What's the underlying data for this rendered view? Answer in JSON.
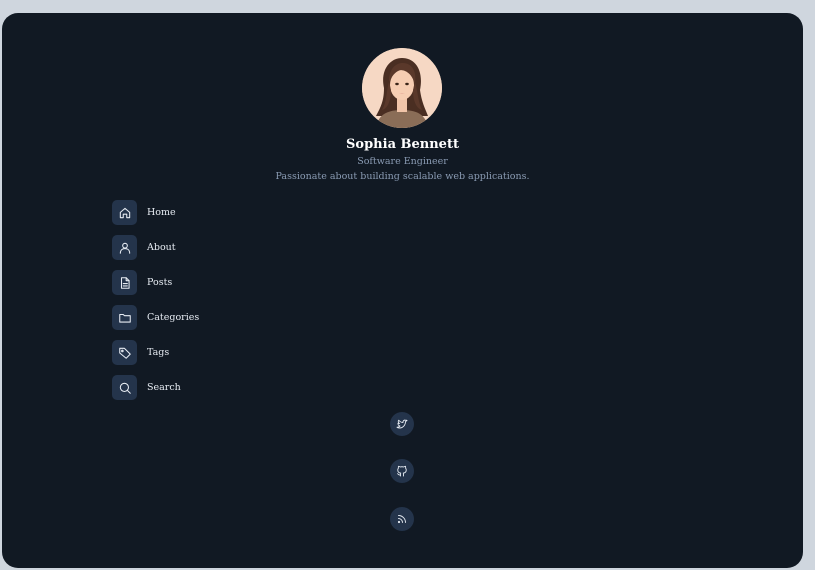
{
  "profile": {
    "name": "Sophia Bennett",
    "role": "Software Engineer",
    "bio": "Passionate about building scalable web applications."
  },
  "nav": {
    "items": [
      {
        "label": "Home",
        "icon": "home-icon"
      },
      {
        "label": "About",
        "icon": "user-icon"
      },
      {
        "label": "Posts",
        "icon": "document-icon"
      },
      {
        "label": "Categories",
        "icon": "folder-icon"
      },
      {
        "label": "Tags",
        "icon": "tag-icon"
      },
      {
        "label": "Search",
        "icon": "search-icon"
      }
    ]
  },
  "social": [
    {
      "icon": "twitter-icon"
    },
    {
      "icon": "github-icon"
    },
    {
      "icon": "rss-icon"
    }
  ],
  "colors": {
    "page_background": "#cfd6de",
    "panel_background": "#111923",
    "icon_tile": "#24344b",
    "text_primary": "#ffffff",
    "text_secondary": "#8a9bb3"
  }
}
